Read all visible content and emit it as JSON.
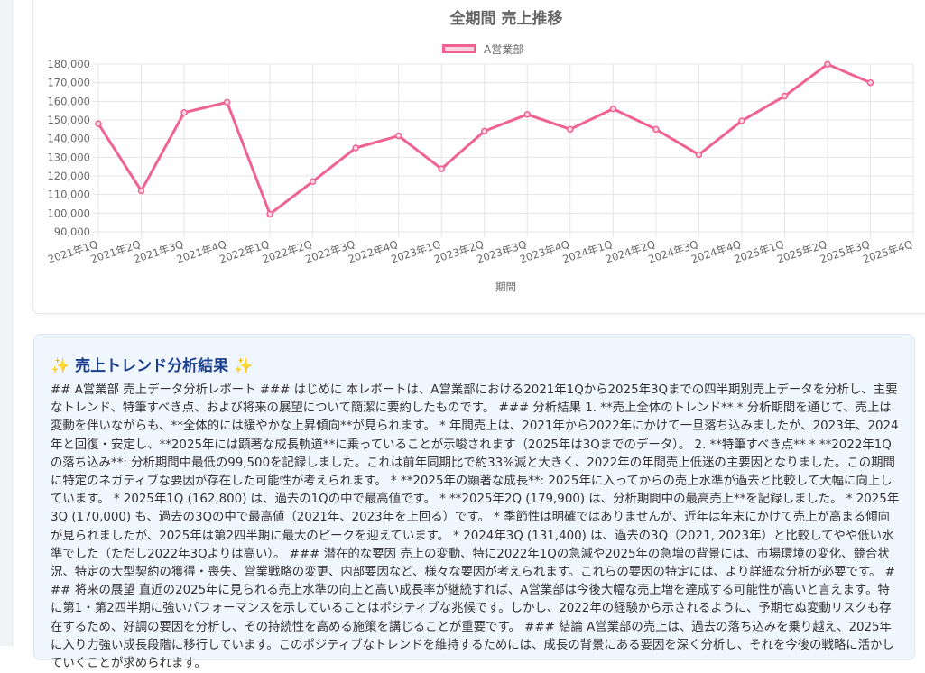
{
  "chart_data": {
    "type": "line",
    "title": "全期間 売上推移",
    "xlabel": "期間",
    "ylabel": "",
    "ylim": [
      90000,
      180000
    ],
    "y_ticks": [
      "180,000",
      "170,000",
      "160,000",
      "150,000",
      "140,000",
      "130,000",
      "120,000",
      "110,000",
      "100,000",
      "90,000"
    ],
    "grid": true,
    "legend_position": "top-center",
    "categories": [
      "2021年1Q",
      "2021年2Q",
      "2021年3Q",
      "2021年4Q",
      "2022年1Q",
      "2022年2Q",
      "2022年3Q",
      "2022年4Q",
      "2023年1Q",
      "2023年2Q",
      "2023年3Q",
      "2023年4Q",
      "2024年1Q",
      "2024年2Q",
      "2024年3Q",
      "2024年4Q",
      "2025年1Q",
      "2025年2Q",
      "2025年3Q",
      "2025年4Q"
    ],
    "series": [
      {
        "name": "A営業部",
        "color": "#f06292",
        "values": [
          148000,
          112000,
          154000,
          159500,
          99500,
          117000,
          135000,
          141500,
          123800,
          144000,
          153000,
          145000,
          156000,
          145000,
          131400,
          149500,
          162800,
          179900,
          170000,
          null
        ]
      }
    ]
  },
  "analysis": {
    "title": "売上トレンド分析結果",
    "sparkle": "✨",
    "body": "## A営業部 売上データ分析レポート ### はじめに 本レポートは、A営業部における2021年1Qから2025年3Qまでの四半期別売上データを分析し、主要なトレンド、特筆すべき点、および将来の展望について簡潔に要約したものです。 ### 分析結果 1. **売上全体のトレンド** * 分析期間を通じて、売上は変動を伴いながらも、**全体的には緩やかな上昇傾向**が見られます。 * 年間売上は、2021年から2022年にかけて一旦落ち込みましたが、2023年、2024年と回復・安定し、**2025年には顕著な成長軌道**に乗っていることが示唆されます（2025年は3Qまでのデータ）。 2. **特筆すべき点** * **2022年1Qの落ち込み**: 分析期間中最低の99,500を記録しました。これは前年同期比で約33%減と大きく、2022年の年間売上低迷の主要因となりました。この期間に特定のネガティブな要因が存在した可能性が考えられます。 * **2025年の顕著な成長**: 2025年に入ってからの売上水準が過去と比較して大幅に向上しています。 * 2025年1Q (162,800) は、過去の1Qの中で最高値です。 * **2025年2Q (179,900) は、分析期間中の最高売上**を記録しました。 * 2025年3Q (170,000) も、過去の3Qの中で最高値（2021年、2023年を上回る）です。 * 季節性は明確ではありませんが、近年は年末にかけて売上が高まる傾向が見られましたが、2025年は第2四半期に最大のピークを迎えています。 * 2024年3Q (131,400) は、過去の3Q（2021, 2023年）と比較してやや低い水準でした（ただし2022年3Qよりは高い）。 ### 潜在的な要因 売上の変動、特に2022年1Qの急減や2025年の急増の背景には、市場環境の変化、競合状況、特定の大型契約の獲得・喪失、営業戦略の変更、内部要因など、様々な要因が考えられます。これらの要因の特定には、より詳細な分析が必要です。 ### 将来の展望 直近の2025年に見られる売上水準の向上と高い成長率が継続すれば、A営業部は今後大幅な売上増を達成する可能性が高いと言えます。特に第1・第2四半期に強いパフォーマンスを示していることはポジティブな兆候です。しかし、2022年の経験から示されるように、予期せぬ変動リスクも存在するため、好調の要因を分析し、その持続性を高める施策を講じることが重要です。 ### 結論 A営業部の売上は、過去の落ち込みを乗り越え、2025年に入り力強い成長段階に移行しています。このポジティブなトレンドを維持するためには、成長の背景にある要因を深く分析し、それを今後の戦略に活かしていくことが求められます。"
  }
}
